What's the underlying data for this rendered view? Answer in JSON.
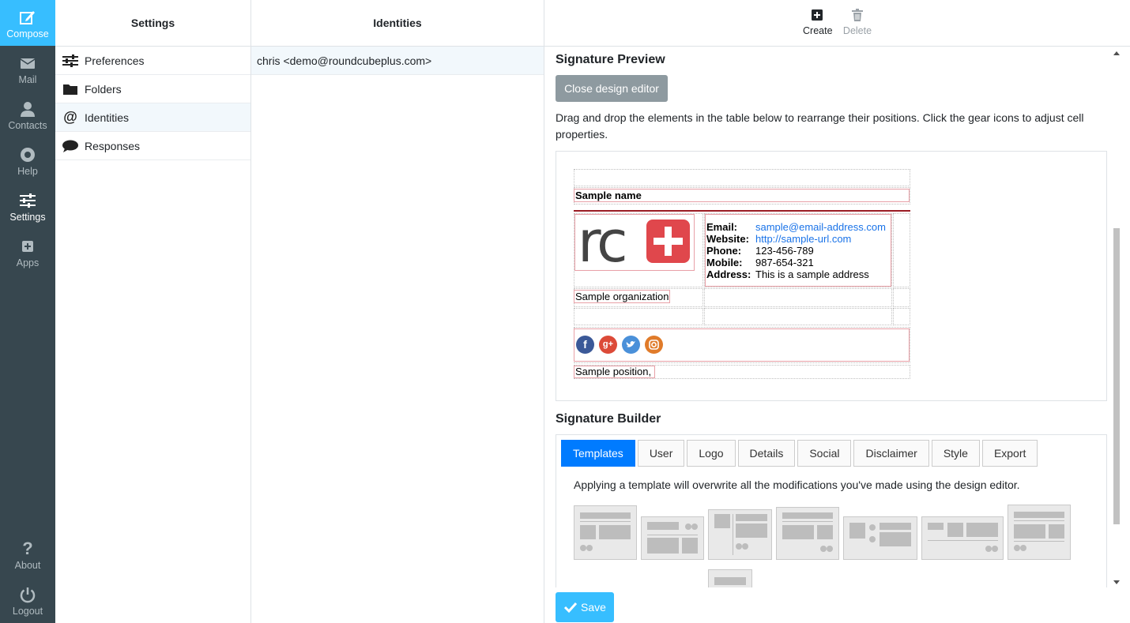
{
  "nav": {
    "compose": "Compose",
    "mail": "Mail",
    "contacts": "Contacts",
    "help": "Help",
    "settings": "Settings",
    "apps": "Apps",
    "about": "About",
    "logout": "Logout"
  },
  "settings": {
    "header": "Settings",
    "items": [
      {
        "label": "Preferences",
        "icon": "sliders-icon"
      },
      {
        "label": "Folders",
        "icon": "folder-icon"
      },
      {
        "label": "Identities",
        "icon": "at-icon"
      },
      {
        "label": "Responses",
        "icon": "speech-bubble-icon"
      }
    ]
  },
  "identities": {
    "header": "Identities",
    "rows": [
      "chris <demo@roundcubeplus.com>"
    ]
  },
  "toolbar": {
    "create": "Create",
    "delete": "Delete"
  },
  "preview": {
    "title": "Signature Preview",
    "close_editor": "Close design editor",
    "instructions": "Drag and drop the elements in the table below to rearrange their positions. Click the gear icons to adjust cell properties."
  },
  "signature": {
    "name": "Sample name",
    "logo_text": "rc",
    "email_label": "Email:",
    "email": "sample@email-address.com",
    "website_label": "Website:",
    "website": "http://sample-url.com",
    "phone_label": "Phone:",
    "phone": "123-456-789",
    "mobile_label": "Mobile:",
    "mobile": "987-654-321",
    "address_label": "Address:",
    "address": "This is a sample address",
    "organization": "Sample organization",
    "position": "Sample position,",
    "social": [
      "facebook-icon",
      "google-plus-icon",
      "twitter-icon",
      "instagram-icon"
    ],
    "social_letters": [
      "f",
      "g+",
      "",
      ""
    ]
  },
  "builder": {
    "title": "Signature Builder",
    "tabs": [
      "Templates",
      "User",
      "Logo",
      "Details",
      "Social",
      "Disclaimer",
      "Style",
      "Export"
    ],
    "active_tab": "Templates",
    "note": "Applying a template will overwrite all the modifications you've made using the design editor."
  },
  "save": "Save",
  "colors": {
    "accent": "#37beff",
    "nav_bg": "#37474f",
    "active_tab": "#007bff",
    "logo_red": "#e0474c"
  }
}
